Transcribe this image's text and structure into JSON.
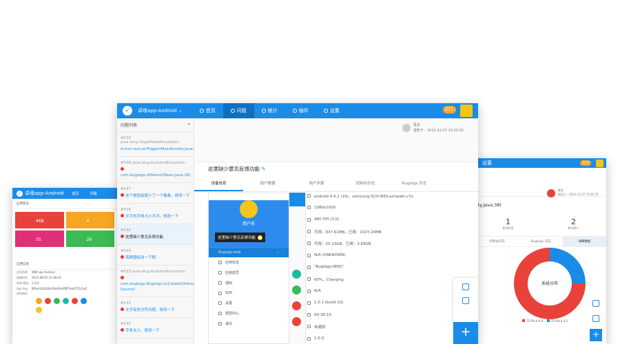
{
  "colors": {
    "primary": "#1a8ce8",
    "badge": "#f5a623",
    "error": "#e33333"
  },
  "left_window": {
    "app": "卓缘app-Android",
    "nav": [
      "首页",
      "问题"
    ],
    "section_status": "应用状态",
    "tiles": [
      {
        "value": "468",
        "color": "#e8423b"
      },
      {
        "value": "4",
        "color": "#f5a623"
      },
      {
        "value": "35",
        "color": "#e0307a"
      },
      {
        "value": "28",
        "color": "#3cba54"
      }
    ],
    "section_info": "应用信息",
    "info": [
      {
        "k": "应用名称",
        "v": "卓缘 app-Android"
      },
      {
        "k": "创建时间",
        "v": "2015-08-05 21:38:20"
      },
      {
        "k": "SDK 版本",
        "v": "1.0.9"
      },
      {
        "k": "App Key",
        "v": "8f0ee3d2d2ba18(a0e4ff8f7ae6725c1a6"
      },
      {
        "k": "应用成员",
        "v": ""
      }
    ]
  },
  "main": {
    "app": "卓缘app-Android",
    "nav": [
      "首页",
      "问题",
      "统计",
      "插件",
      "设置"
    ],
    "badge": "213",
    "sidebar_title": "问题列表",
    "collapse": "«",
    "issues": [
      {
        "id": "#539 java.lang.IllegalStateException",
        "title": "io.kvh.test.onTrigger(MainActivity.java:38)",
        "dot": false,
        "dark": false
      },
      {
        "id": "#538 java.lang.RuntimeException",
        "title": "com.bugtags.different(Bean.java:18)",
        "dot": true,
        "dark": false
      },
      {
        "id": "#537",
        "title": "这个按钮高度小了一个像素，修改一下",
        "dot": true,
        "dark": false
      },
      {
        "id": "#536",
        "title": "文字的字体大小不对，修改一下",
        "dot": true,
        "dark": false
      },
      {
        "id": "#535",
        "title": "这里缺少意见反馈功能",
        "dot": true,
        "dark": true
      },
      {
        "id": "#534",
        "title": "首屏图标改一下啊",
        "dot": true,
        "dark": false
      },
      {
        "id": "#533 java.lang.RuntimeException",
        "title": "com.bugtags.Bugtags.onCreate(Unknown Source)",
        "dot": true,
        "dark": false
      },
      {
        "id": "#532",
        "title": "文字有些对齐问题，修改一下",
        "dot": true,
        "dark": false
      },
      {
        "id": "#531",
        "title": "字体太小，修改一下",
        "dot": true,
        "dark": false
      }
    ],
    "reporter_name": "匿名",
    "reporter_time": "报告于：2015-12-07 15:01:55",
    "title": "这里缺少意见反馈功能",
    "edit_icon": "✎",
    "tabs": [
      "设备信息",
      "用户数据",
      "用户步骤",
      "控制台日志",
      "Bugtags 日志"
    ],
    "phone": {
      "username": "用户名",
      "select": "Bugtags-web",
      "menu": [
        "应用信息",
        "应用成员",
        "通知",
        "SDK",
        "设置",
        "帮助中心",
        "退出"
      ]
    },
    "tooltip": "这里缺少意见反馈功能",
    "device": [
      "android 4.4.2 (19)，samsung,SCH-I959,armeabi-v7a",
      "1080x1920",
      "480 DPI (3.0)",
      "可用：837.61MB，已用：1023.24MB",
      "可用：20.13GB，已用：3.69GB",
      "N/A (UNKNOWN)",
      "\"Bugtags-Wifi2\"",
      "60%，Charging",
      "N/A",
      "1.0.1 (build 10)",
      "00:36:19",
      "未越狱",
      "1.0.9"
    ],
    "fab": "+"
  },
  "right_window": {
    "nav": "设置",
    "badge": "213",
    "reporter_name": "匿名",
    "reporter_time": "报告于：2015-12-07 15:01:55",
    "exception_tail": "ity.java:38)",
    "stats": [
      {
        "n": "1",
        "l": "影响机型"
      },
      {
        "n": "2",
        "l": "影响用户"
      }
    ],
    "tabs": [
      "控制台日志",
      "Bugtags 日志",
      "详细数据"
    ],
    "chart_data": {
      "type": "pie",
      "title": "系统分布",
      "categories": [
        "4.4.4",
        "4.4.2"
      ],
      "values": [
        75,
        25
      ],
      "colors": [
        "#e8423b",
        "#1a8ce8"
      ],
      "legend": [
        "75.0% 4.4.4",
        "25.0% 4.4.2"
      ]
    },
    "fab": "+"
  }
}
